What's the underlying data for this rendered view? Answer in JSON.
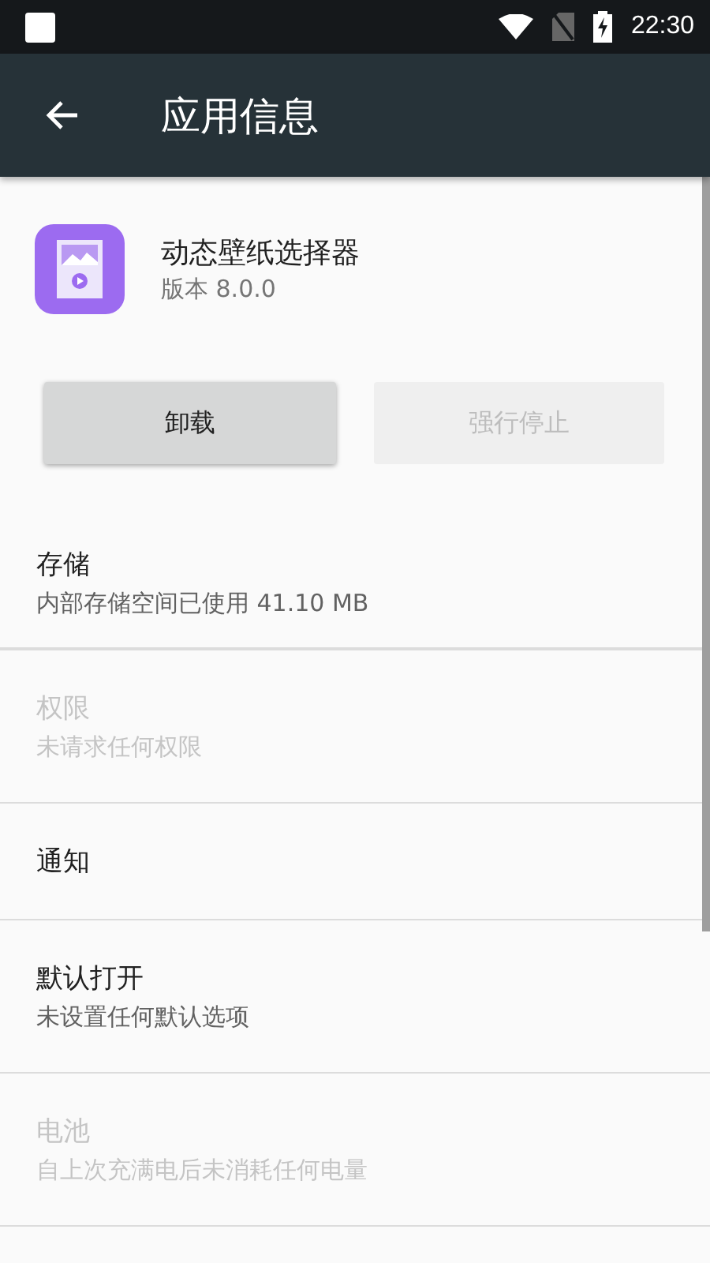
{
  "status_bar": {
    "time": "22:30"
  },
  "toolbar": {
    "title": "应用信息"
  },
  "app": {
    "name": "动态壁纸选择器",
    "version": "版本 8.0.0"
  },
  "buttons": [
    {
      "label": "卸载",
      "disabled": false
    },
    {
      "label": "强行停止",
      "disabled": true
    }
  ],
  "sections": [
    {
      "title": "存储",
      "summary": "内部存储空间已使用 41.10 MB",
      "disabled": false
    },
    {
      "title": "权限",
      "summary": "未请求任何权限",
      "disabled": true
    },
    {
      "title": "通知",
      "disabled": false
    },
    {
      "title": "默认打开",
      "summary": "未设置任何默认选项",
      "disabled": false
    },
    {
      "title": "电池",
      "summary": "自上次充满电后未消耗任何电量",
      "disabled": true
    }
  ]
}
